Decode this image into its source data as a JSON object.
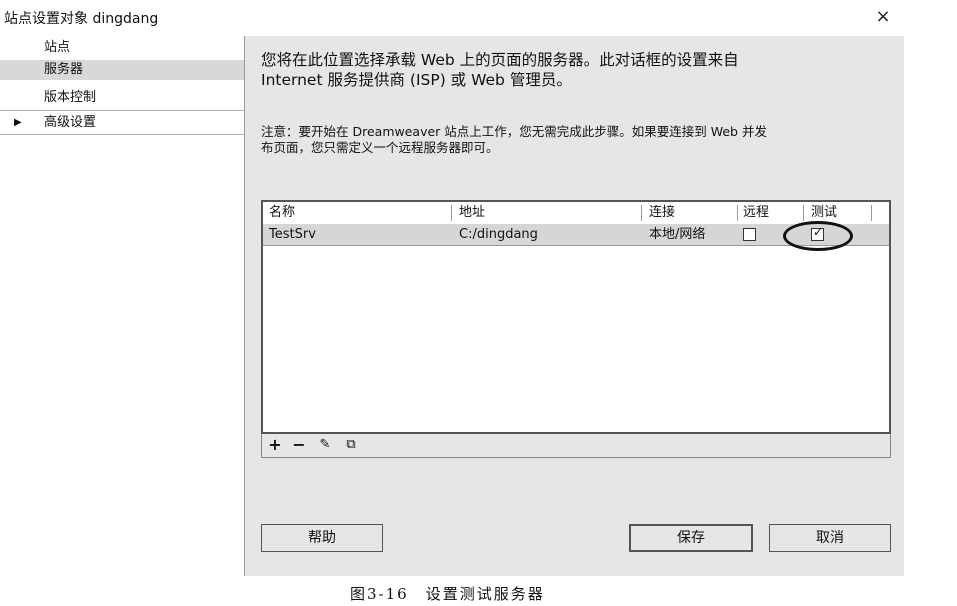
{
  "window": {
    "title": "站点设置对象 dingdang",
    "close_label": "×"
  },
  "sidebar": {
    "items": [
      {
        "label": "站点"
      },
      {
        "label": "服务器"
      },
      {
        "label": "版本控制"
      },
      {
        "label": "高级设置",
        "expand_arrow": "▶"
      }
    ]
  },
  "main": {
    "intro_line1": "您将在此位置选择承载 Web 上的页面的服务器。此对话框的设置来自",
    "intro_line2": "Internet 服务提供商 (ISP) 或 Web 管理员。",
    "note_line1": "注意：要开始在 Dreamweaver 站点上工作，您无需完成此步骤。如果要连接到 Web 并发",
    "note_line2": "布页面，您只需定义一个远程服务器即可。"
  },
  "server_table": {
    "headers": {
      "name": "名称",
      "address": "地址",
      "connection": "连接",
      "remote": "远程",
      "test": "测试"
    },
    "rows": [
      {
        "name": "TestSrv",
        "address": "C:/dingdang",
        "connection": "本地/网络",
        "remote": false,
        "test": true
      }
    ]
  },
  "toolbar": {
    "add": "+",
    "remove": "−",
    "edit": "✎",
    "copy": "⧉"
  },
  "buttons": {
    "help": "帮助",
    "save": "保存",
    "cancel": "取消"
  },
  "caption": "图3-16　设置测试服务器"
}
